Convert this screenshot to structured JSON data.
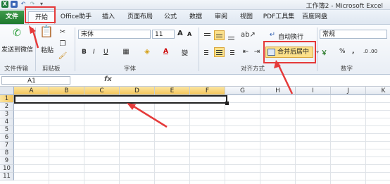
{
  "titlebar": {
    "title": "工作簿2 - Microsoft Excel",
    "quick_access": [
      "excel-icon",
      "save-icon",
      "undo-icon",
      "redo-icon",
      "customize-icon"
    ]
  },
  "tabs": [
    "文件",
    "开始",
    "Office助手",
    "插入",
    "页面布局",
    "公式",
    "数据",
    "审阅",
    "视图",
    "PDF工具集",
    "百度网盘"
  ],
  "ribbon": {
    "send_label": "发送到微信",
    "paste_label": "粘贴",
    "font_name": "宋体",
    "font_size": "11",
    "grow_font": "A",
    "shrink_font": "A",
    "bold": "B",
    "italic": "I",
    "underline": "U",
    "font_color_letter": "A",
    "phonetic": "變",
    "wrap_text_label": "自动换行",
    "merge_center_label": "合并后居中",
    "number_format": "常规",
    "percent": "%",
    "comma": ",",
    "inc_decimal": ".0 .00",
    "currency_symbol": "￥",
    "groups": {
      "file_transfer": "文件传输",
      "clipboard": "剪贴板",
      "font": "字体",
      "alignment": "对齐方式",
      "number": "数字"
    }
  },
  "formula_bar": {
    "name_box": "A1",
    "fx_label": "fx",
    "content": ""
  },
  "grid": {
    "columns": [
      "A",
      "B",
      "C",
      "D",
      "E",
      "F",
      "G",
      "H",
      "I",
      "J",
      "K"
    ],
    "selected_columns": [
      "A",
      "B",
      "C",
      "D",
      "E",
      "F"
    ],
    "rows": [
      "1",
      "2",
      "3",
      "4",
      "5",
      "6",
      "7",
      "8",
      "9",
      "10",
      "11"
    ],
    "selected_row": "1"
  },
  "colors": {
    "file_tab": "#1f7a2f",
    "highlight": "#e53a3a",
    "active_button": "#fbe08a"
  }
}
